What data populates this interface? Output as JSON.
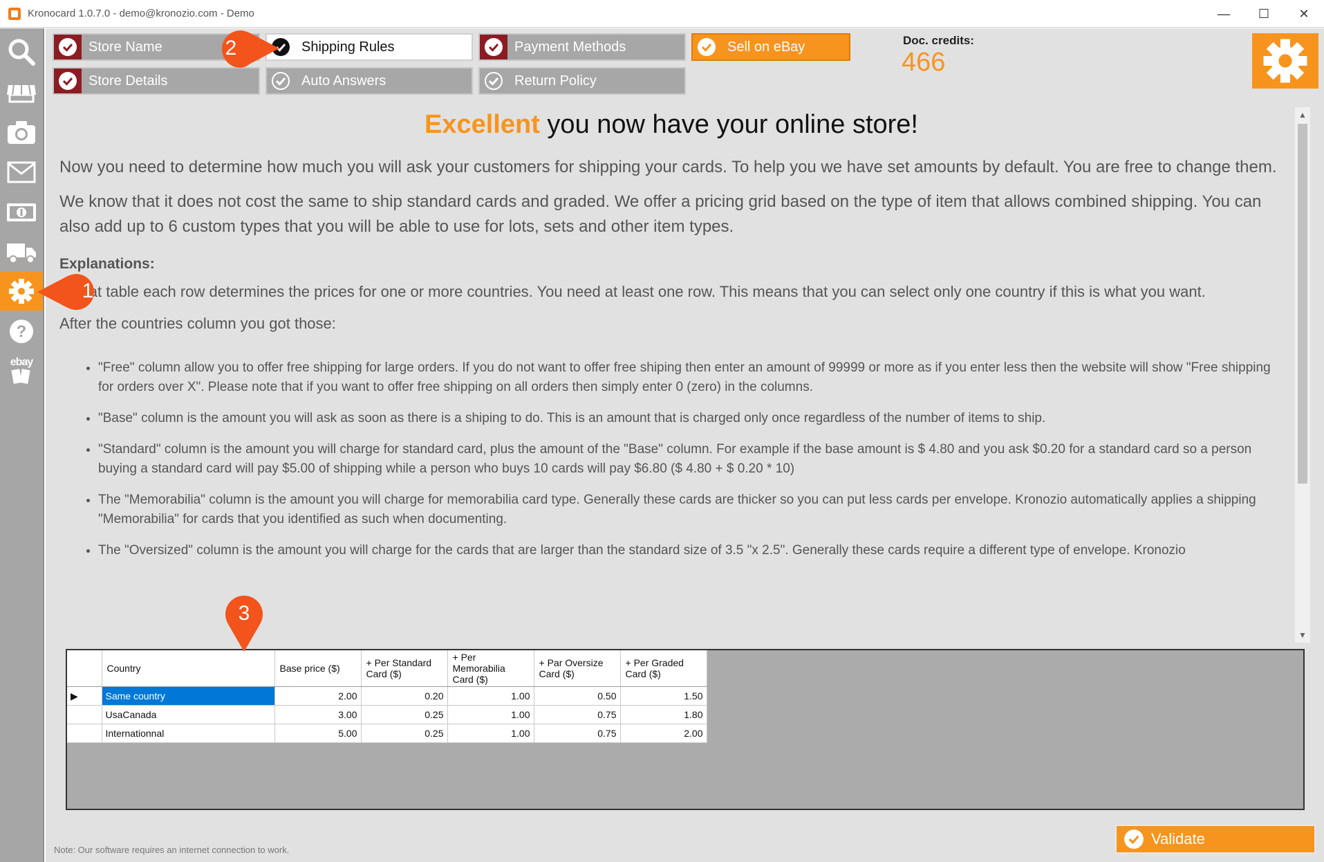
{
  "window": {
    "title": "Kronocard 1.0.7.0 - demo@kronozio.com - Demo",
    "minimize_glyph": "—",
    "maximize_glyph": "☐",
    "close_glyph": "✕"
  },
  "sidebar": {
    "items": [
      {
        "icon": "search-icon"
      },
      {
        "icon": "store-awning-icon"
      },
      {
        "icon": "camera-icon"
      },
      {
        "icon": "envelope-icon"
      },
      {
        "icon": "money-icon"
      },
      {
        "icon": "truck-icon"
      },
      {
        "icon": "gear-icon",
        "active": true
      },
      {
        "icon": "help-icon"
      },
      {
        "icon": "ebay-icon",
        "label": "ebay"
      }
    ]
  },
  "steps": {
    "store_name": "Store Name",
    "shipping_rules": "Shipping Rules",
    "payment_methods": "Payment Methods",
    "sell_on_ebay": "Sell on eBay",
    "store_details": "Store Details",
    "auto_answers": "Auto Answers",
    "return_policy": "Return Policy"
  },
  "credits": {
    "label": "Doc. credits:",
    "value": "466"
  },
  "content": {
    "headline_highlight": "Excellent",
    "headline_rest": " you now have your online store!",
    "para1": "Now you need to determine how much you will ask your customers for shipping your cards. To help you we have set amounts by default. You are free to change them.",
    "para2": "We know that it does not cost the same to ship standard cards and graded. We offer a pricing grid based on the type of item that allows combined shipping. You can also add up to 6 custom types that you will be able to use for lots, sets and other item types.",
    "explanations_title": "Explanations:",
    "para3": "In that table each row determines the prices for one or more countries. You need at least one row. This means that you can select only one country if this is what you want.",
    "para4": "After the countries column you got those:",
    "bullets": [
      "\"Free\" column allow you to offer free shipping for large orders. If you do not want to offer free shiping then enter an amount of 99999 or more as if you enter less then the website will show \"Free shipping for orders over X\". Please note that if you want to offer free shipping on all orders then simply enter 0 (zero) in the columns.",
      "\"Base\" column is the amount you will ask as soon as there is a shiping to do. This is an amount that is charged only once regardless of the number of items to ship.",
      "\"Standard\" column is the amount you will charge for standard card, plus the amount of the \"Base\" column. For example if the base amount is $ 4.80 and you ask $0.20 for a standard card so a person buying a standard card will pay $5.00 of shipping while a person who buys 10 cards will pay $6.80 ($ 4.80 + $ 0.20 * 10)",
      "The \"Memorabilia\" column is the amount you will charge for memorabilia card type. Generally these cards are thicker so you can put less cards per envelope. Kronozio automatically applies a shipping \"Memorabilia\" for cards that you identified as such when documenting.",
      "The \"Oversized\" column is the amount you will charge for the cards that are larger than the standard size of 3.5 \"x 2.5\". Generally these cards require a different type of envelope. Kronozio"
    ]
  },
  "grid": {
    "columns": [
      "Country",
      "Base price ($)",
      "+ Per Standard Card ($)",
      "+ Per Memorabilia Card ($)",
      "+ Par Oversize Card ($)",
      "+ Per Graded Card ($)"
    ],
    "rows": [
      {
        "country": "Same country",
        "base": "2.00",
        "standard": "0.20",
        "memorabilia": "1.00",
        "oversize": "0.50",
        "graded": "1.50"
      },
      {
        "country": "UsaCanada",
        "base": "3.00",
        "standard": "0.25",
        "memorabilia": "1.00",
        "oversize": "0.75",
        "graded": "1.80"
      },
      {
        "country": "Internationnal",
        "base": "5.00",
        "standard": "0.25",
        "memorabilia": "1.00",
        "oversize": "0.75",
        "graded": "2.00"
      }
    ],
    "current_row_marker": "▶"
  },
  "footer": {
    "note": "Note: Our software requires an internet connection to work.",
    "validate_label": "Validate"
  },
  "callouts": [
    "1",
    "2",
    "3"
  ],
  "colors": {
    "accent_orange": "#f7941d",
    "step_done_red": "#8b1c23",
    "selection_blue": "#0078d7"
  }
}
